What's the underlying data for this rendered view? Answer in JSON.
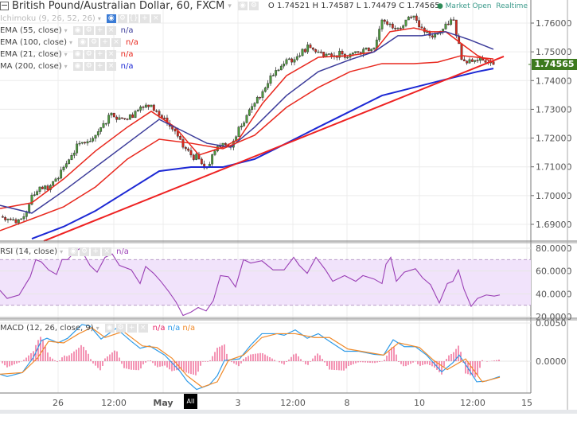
{
  "header": {
    "symbol_title": "British Pound/Australian Dollar, 60, FXCM",
    "ohlc": {
      "open_label": "O",
      "open": "1.74521",
      "high_label": "H",
      "high": "1.74587",
      "low_label": "L",
      "low": "1.74479",
      "close_label": "C",
      "close": "1.74565"
    },
    "status_open": "Market Open",
    "status_realtime": "Realtime"
  },
  "indicators": [
    {
      "label": "Ichimoku (9, 26, 52, 26)",
      "value": "",
      "color": "#bbbbbb"
    },
    {
      "label": "EMA (55, close)",
      "value": "n/a",
      "color": "#3b3b9a"
    },
    {
      "label": "EMA (100, close)",
      "value": "n/a",
      "color": "#e8281e"
    },
    {
      "label": "EMA (21, close)",
      "value": "n/a",
      "color": "#e8281e"
    },
    {
      "label": "MA (200, close)",
      "value": "n/a",
      "color": "#1c28d4"
    }
  ],
  "rsi_legend": {
    "label": "RSI (14, close)",
    "value": "n/a",
    "color": "#9a3fb5"
  },
  "macd_legend": {
    "label": "MACD (12, 26, close, 9)",
    "values": [
      "n/a",
      "n/a",
      "n/a"
    ],
    "colors": [
      "#e8286a",
      "#2f9be8",
      "#f08a2a"
    ]
  },
  "current_price": "1.74565",
  "all_marker": "All",
  "chart_data": [
    {
      "type": "candlestick",
      "title": "British Pound/Australian Dollar, 60, FXCM",
      "x_unit": "bar",
      "price_axis": {
        "ticks": [
          "1.76000",
          "1.75000",
          "1.74000",
          "1.73000",
          "1.72000",
          "1.71000",
          "1.70000",
          "1.69000"
        ],
        "ylim": [
          1.684,
          1.764
        ]
      },
      "time_axis": {
        "ticks": [
          "26",
          "12:00",
          "May",
          "3",
          "12:00",
          "8",
          "10",
          "12:00",
          "15"
        ]
      },
      "closes": [
        1.6927,
        1.6919,
        1.6905,
        1.6927,
        1.7002,
        1.703,
        1.702,
        1.7058,
        1.7099,
        1.714,
        1.7182,
        1.7188,
        1.721,
        1.7251,
        1.7287,
        1.7271,
        1.7265,
        1.7293,
        1.7307,
        1.7315,
        1.7279,
        1.7251,
        1.7224,
        1.7168,
        1.7141,
        1.7127,
        1.7099,
        1.7155,
        1.7182,
        1.7168,
        1.7238,
        1.7279,
        1.7321,
        1.7362,
        1.7417,
        1.7437,
        1.7473,
        1.7473,
        1.7509,
        1.7514,
        1.75,
        1.7492,
        1.7487,
        1.7492,
        1.7492,
        1.7498,
        1.7514,
        1.7514,
        1.7611,
        1.7597,
        1.7583,
        1.7611,
        1.7625,
        1.7583,
        1.7556,
        1.7564,
        1.7597,
        1.7611,
        1.7473,
        1.7473,
        1.747,
        1.7464,
        1.7456
      ],
      "lines": [
        {
          "name": "EMA (21, close)",
          "color": "#e8281e",
          "points": [
            [
              0,
              1.6955
            ],
            [
              4,
              1.6975
            ],
            [
              8,
              1.7058
            ],
            [
              12,
              1.7155
            ],
            [
              16,
              1.7238
            ],
            [
              19,
              1.7293
            ],
            [
              22,
              1.7238
            ],
            [
              25,
              1.7141
            ],
            [
              28,
              1.7168
            ],
            [
              30,
              1.7196
            ],
            [
              33,
              1.7321
            ],
            [
              36,
              1.7417
            ],
            [
              40,
              1.7481
            ],
            [
              44,
              1.7487
            ],
            [
              47,
              1.75
            ],
            [
              49,
              1.757
            ],
            [
              52,
              1.7583
            ],
            [
              54,
              1.757
            ],
            [
              56,
              1.757
            ],
            [
              58,
              1.7528
            ],
            [
              60,
              1.7487
            ],
            [
              62,
              1.7464
            ]
          ]
        },
        {
          "name": "EMA (55, close)",
          "color": "#3b3b9a",
          "points": [
            [
              0,
              1.6966
            ],
            [
              4,
              1.6939
            ],
            [
              8,
              1.7016
            ],
            [
              12,
              1.7099
            ],
            [
              16,
              1.7182
            ],
            [
              20,
              1.7265
            ],
            [
              23,
              1.7224
            ],
            [
              26,
              1.7182
            ],
            [
              29,
              1.7168
            ],
            [
              32,
              1.7238
            ],
            [
              36,
              1.7348
            ],
            [
              40,
              1.7431
            ],
            [
              44,
              1.7473
            ],
            [
              47,
              1.75
            ],
            [
              50,
              1.7556
            ],
            [
              53,
              1.7556
            ],
            [
              56,
              1.757
            ],
            [
              59,
              1.7542
            ],
            [
              62,
              1.7509
            ]
          ]
        },
        {
          "name": "EMA (100, close)",
          "color": "#e8281e",
          "points": [
            [
              0,
              1.6878
            ],
            [
              4,
              1.6919
            ],
            [
              8,
              1.6961
            ],
            [
              12,
              1.703
            ],
            [
              16,
              1.7127
            ],
            [
              20,
              1.7196
            ],
            [
              24,
              1.7182
            ],
            [
              28,
              1.7163
            ],
            [
              32,
              1.721
            ],
            [
              36,
              1.7307
            ],
            [
              40,
              1.7376
            ],
            [
              44,
              1.7431
            ],
            [
              48,
              1.7459
            ],
            [
              52,
              1.7459
            ],
            [
              55,
              1.7464
            ],
            [
              58,
              1.7487
            ],
            [
              62,
              1.7475
            ]
          ]
        },
        {
          "name": "MA (200, close)",
          "color": "#1c28d4",
          "points": [
            [
              4,
              1.685
            ],
            [
              8,
              1.6892
            ],
            [
              12,
              1.6947
            ],
            [
              16,
              1.7016
            ],
            [
              20,
              1.7085
            ],
            [
              24,
              1.7099
            ],
            [
              28,
              1.7099
            ],
            [
              32,
              1.7127
            ],
            [
              36,
              1.7182
            ],
            [
              40,
              1.7238
            ],
            [
              44,
              1.7293
            ],
            [
              48,
              1.7348
            ],
            [
              52,
              1.7376
            ],
            [
              56,
              1.7404
            ],
            [
              60,
              1.7431
            ],
            [
              62,
              1.7442
            ]
          ]
        }
      ],
      "trendline": {
        "color": "#ee2222",
        "points": [
          [
            5.5,
            1.6842
          ],
          [
            63.3,
            1.7484
          ]
        ]
      }
    },
    {
      "type": "line",
      "title": "RSI (14, close)",
      "ticks": [
        "80.0000",
        "60.0000",
        "40.0000",
        "20.0000"
      ],
      "ylim": [
        20,
        80
      ],
      "band": [
        30,
        70
      ],
      "band_color": "#f1e3fb",
      "line_color": "#9a3fb5",
      "points": [
        [
          0,
          43
        ],
        [
          0.9,
          36
        ],
        [
          2.4,
          39
        ],
        [
          3.8,
          55
        ],
        [
          4.5,
          70
        ],
        [
          5.2,
          68
        ],
        [
          6.1,
          61
        ],
        [
          7.1,
          57
        ],
        [
          7.8,
          70
        ],
        [
          8.5,
          70
        ],
        [
          9.4,
          77
        ],
        [
          10.1,
          80
        ],
        [
          11.3,
          65
        ],
        [
          12.2,
          59
        ],
        [
          13.2,
          72
        ],
        [
          14.1,
          75
        ],
        [
          15,
          65
        ],
        [
          16.5,
          61
        ],
        [
          17.6,
          49
        ],
        [
          18.3,
          64
        ],
        [
          19.3,
          58
        ],
        [
          20.2,
          51
        ],
        [
          21.2,
          42
        ],
        [
          22.1,
          33
        ],
        [
          23,
          21
        ],
        [
          24,
          24
        ],
        [
          24.9,
          28
        ],
        [
          25.9,
          25
        ],
        [
          26.8,
          34
        ],
        [
          27.7,
          56
        ],
        [
          28.7,
          55
        ],
        [
          29.6,
          46
        ],
        [
          30.6,
          70
        ],
        [
          31.5,
          67
        ],
        [
          32.9,
          69
        ],
        [
          34.3,
          61
        ],
        [
          35.7,
          61
        ],
        [
          36.9,
          72
        ],
        [
          37.6,
          65
        ],
        [
          38.6,
          58
        ],
        [
          39.7,
          72
        ],
        [
          40.9,
          61
        ],
        [
          41.8,
          51
        ],
        [
          43.3,
          56
        ],
        [
          44.7,
          51
        ],
        [
          45.6,
          56
        ],
        [
          47,
          53
        ],
        [
          48,
          49
        ],
        [
          48.5,
          66
        ],
        [
          49.1,
          72
        ],
        [
          49.8,
          51
        ],
        [
          50.8,
          59
        ],
        [
          52.2,
          62
        ],
        [
          53.1,
          54
        ],
        [
          54.1,
          48
        ],
        [
          55.2,
          32
        ],
        [
          56.2,
          49
        ],
        [
          56.9,
          51
        ],
        [
          57.6,
          61
        ],
        [
          58.3,
          44
        ],
        [
          59.2,
          29
        ],
        [
          60,
          36
        ],
        [
          61.1,
          39
        ],
        [
          62.1,
          38
        ],
        [
          62.8,
          39
        ]
      ]
    },
    {
      "type": "line",
      "title": "MACD (12, 26, close, 9)",
      "ticks": [
        "0.0050",
        "0.0000"
      ],
      "ylim": [
        -0.004,
        0.005
      ],
      "series": [
        {
          "color": "#2f9be8",
          "points": [
            [
              0,
              -0.0017
            ],
            [
              0.9,
              -0.002
            ],
            [
              2.8,
              -0.0015
            ],
            [
              4.2,
              0.0005
            ],
            [
              5.2,
              0.0027
            ],
            [
              5.9,
              0.003
            ],
            [
              7.3,
              0.0024
            ],
            [
              8.5,
              0.003
            ],
            [
              10.3,
              0.0048
            ],
            [
              11.3,
              0.0046
            ],
            [
              12.7,
              0.0029
            ],
            [
              14.6,
              0.0043
            ],
            [
              16.5,
              0.0026
            ],
            [
              17.6,
              0.0017
            ],
            [
              18.8,
              0.002
            ],
            [
              20.7,
              0.0008
            ],
            [
              22.6,
              -0.0013
            ],
            [
              23.5,
              -0.0026
            ],
            [
              24.7,
              -0.0037
            ],
            [
              26.3,
              -0.0031
            ],
            [
              27.3,
              -0.0019
            ],
            [
              28.2,
              0.0001
            ],
            [
              30.1,
              0.0003
            ],
            [
              31.5,
              0.0021
            ],
            [
              32.9,
              0.0036
            ],
            [
              34.8,
              0.0036
            ],
            [
              35.7,
              0.0034
            ],
            [
              37.1,
              0.0041
            ],
            [
              38.6,
              0.003
            ],
            [
              40,
              0.0036
            ],
            [
              41.4,
              0.0026
            ],
            [
              43.3,
              0.0013
            ],
            [
              45.1,
              0.0013
            ],
            [
              47,
              0.0009
            ],
            [
              48.2,
              0.0008
            ],
            [
              49.4,
              0.0028
            ],
            [
              50.8,
              0.0019
            ],
            [
              52.2,
              0.0019
            ],
            [
              53.6,
              0.0008
            ],
            [
              55.5,
              -0.0014
            ],
            [
              56.9,
              -0.0002
            ],
            [
              57.7,
              0.0008
            ],
            [
              58.8,
              -0.0009
            ],
            [
              59.9,
              -0.0027
            ],
            [
              61.1,
              -0.0026
            ],
            [
              62.8,
              -0.002
            ]
          ]
        },
        {
          "color": "#f08a2a",
          "points": [
            [
              0,
              -0.0017
            ],
            [
              2.8,
              -0.0015
            ],
            [
              4.7,
              0.0004
            ],
            [
              6.1,
              0.0026
            ],
            [
              8,
              0.0024
            ],
            [
              9.9,
              0.0036
            ],
            [
              11.5,
              0.0044
            ],
            [
              13.2,
              0.0031
            ],
            [
              15.5,
              0.0039
            ],
            [
              17.9,
              0.002
            ],
            [
              19.7,
              0.0018
            ],
            [
              21.6,
              0.0004
            ],
            [
              23.5,
              -0.0019
            ],
            [
              25.4,
              -0.0034
            ],
            [
              27.3,
              -0.0027
            ],
            [
              28.7,
              0.0001
            ],
            [
              30.6,
              0.0008
            ],
            [
              32.9,
              0.0031
            ],
            [
              34.8,
              0.0036
            ],
            [
              37.1,
              0.0036
            ],
            [
              39.5,
              0.0031
            ],
            [
              41.4,
              0.0031
            ],
            [
              43.7,
              0.0016
            ],
            [
              48.2,
              0.0008
            ],
            [
              50.1,
              0.0024
            ],
            [
              52.7,
              0.0018
            ],
            [
              54.5,
              0.0001
            ],
            [
              56.2,
              -0.0011
            ],
            [
              58.5,
              0.0003
            ],
            [
              60.6,
              -0.0027
            ],
            [
              62.8,
              -0.0021
            ]
          ]
        }
      ],
      "histogram_color": "#e8286a"
    }
  ]
}
